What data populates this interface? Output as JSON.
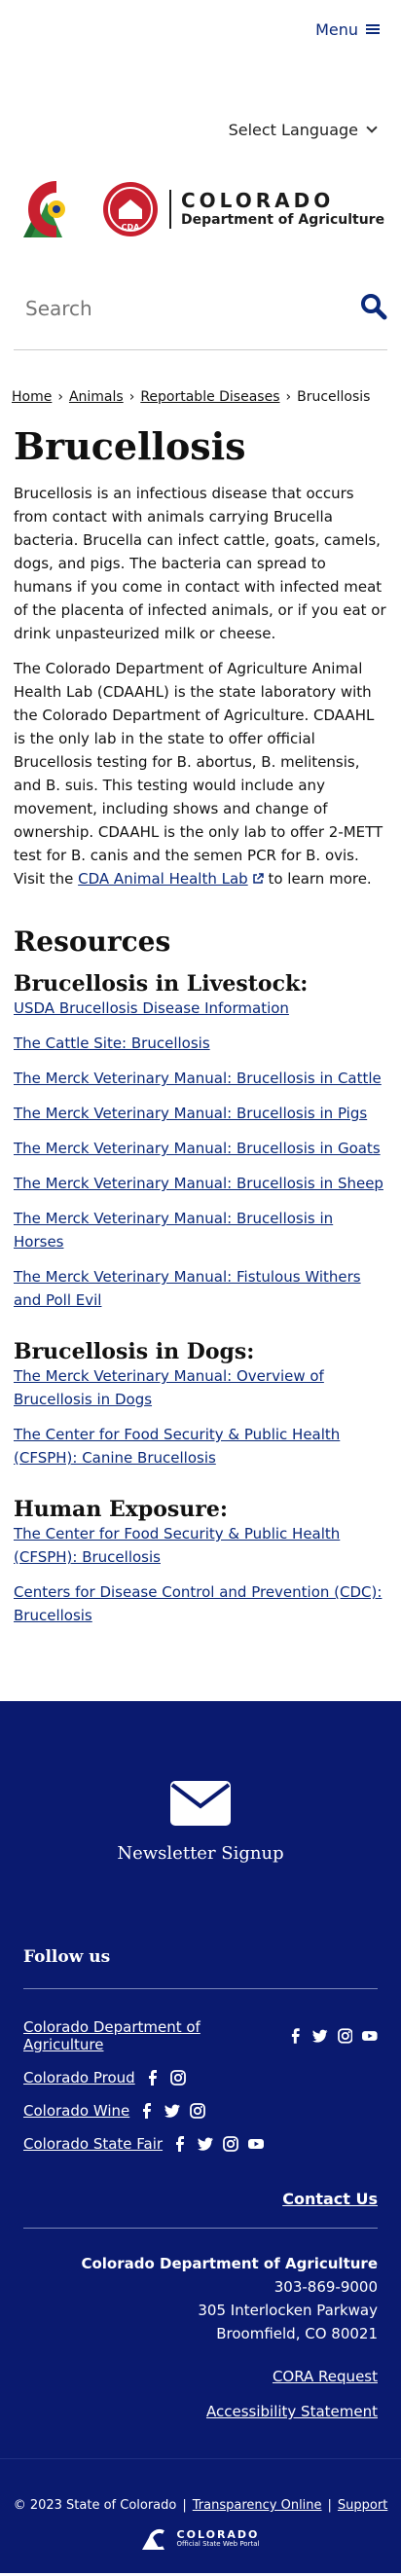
{
  "header": {
    "menu_label": "Menu",
    "language_label": "Select Language",
    "logo_line1": "COLORADO",
    "logo_line2": "Department of Agriculture",
    "logo_badge": "CDA",
    "search_placeholder": "Search"
  },
  "breadcrumb": {
    "home": "Home",
    "animals": "Animals",
    "reportable": "Reportable Diseases",
    "current": "Brucellosis",
    "separator": "›"
  },
  "page": {
    "title": "Brucellosis",
    "para1": "Brucellosis is an infectious disease that occurs from contact with animals carrying Brucella bacteria. Brucella can infect cattle, goats, camels, dogs, and pigs. The bacteria can spread to humans if you come in contact with infected meat of the placenta of infected animals, or if you eat or drink unpasteurized milk or cheese.",
    "para2_text": "The Colorado Department of Agriculture Animal Health Lab (CDAAHL) is the state laboratory with the Colorado Department of Agriculture. CDAAHL is the only lab in the state to offer official Brucellosis testing for B. abortus, B. melitensis, and B. suis. This testing would include any movement, including shows and change of ownership. CDAAHL is the only lab to offer 2-METT test for B. canis and the semen PCR for B. ovis. Visit the",
    "para2_link": "CDA Animal Health Lab",
    "para2_end": "to learn more."
  },
  "resources": {
    "heading": "Resources",
    "livestock_heading": "Brucellosis in Livestock:",
    "livestock_links": [
      "USDA Brucellosis Disease Information",
      "The Cattle Site: Brucellosis",
      "The Merck Veterinary Manual: Brucellosis in Cattle",
      "The Merck Veterinary Manual: Brucellosis in Pigs",
      "The Merck Veterinary Manual: Brucellosis in Goats",
      "The Merck Veterinary Manual: Brucellosis in Sheep",
      "The Merck Veterinary Manual: Brucellosis in Horses",
      "The Merck Veterinary Manual: Fistulous Withers and Poll Evil"
    ],
    "dogs_heading": "Brucellosis in Dogs:",
    "dogs_links": [
      "The Merck Veterinary Manual: Overview of Brucellosis in Dogs",
      "The Center for Food Security & Public Health (CFSPH): Canine Brucellosis"
    ],
    "human_heading": "Human Exposure:",
    "human_links": [
      "The Center for Food Security & Public Health (CFSPH): Brucellosis",
      "Centers for Disease Control and Prevention (CDC): Brucellosis"
    ]
  },
  "footer": {
    "newsletter": "Newsletter Signup",
    "follow": "Follow us",
    "social": [
      "Colorado Department of Agriculture",
      "Colorado Proud",
      "Colorado Wine",
      "Colorado State Fair"
    ],
    "contact": "Contact Us",
    "org": "Colorado Department of Agriculture",
    "phone": "303-869-9000",
    "street": "305 Interlocken Parkway",
    "city": "Broomfield, CO 80021",
    "cora": "CORA Request",
    "accessibility": "Accessibility Statement",
    "copyright": "© 2023 State of Colorado",
    "transparency": "Transparency Online",
    "support": "Support",
    "portal_line1": "COLORADO",
    "portal_line2": "Official State Web Portal"
  },
  "colors": {
    "navy": "#0a1a6f",
    "link": "#0b2a7a"
  }
}
